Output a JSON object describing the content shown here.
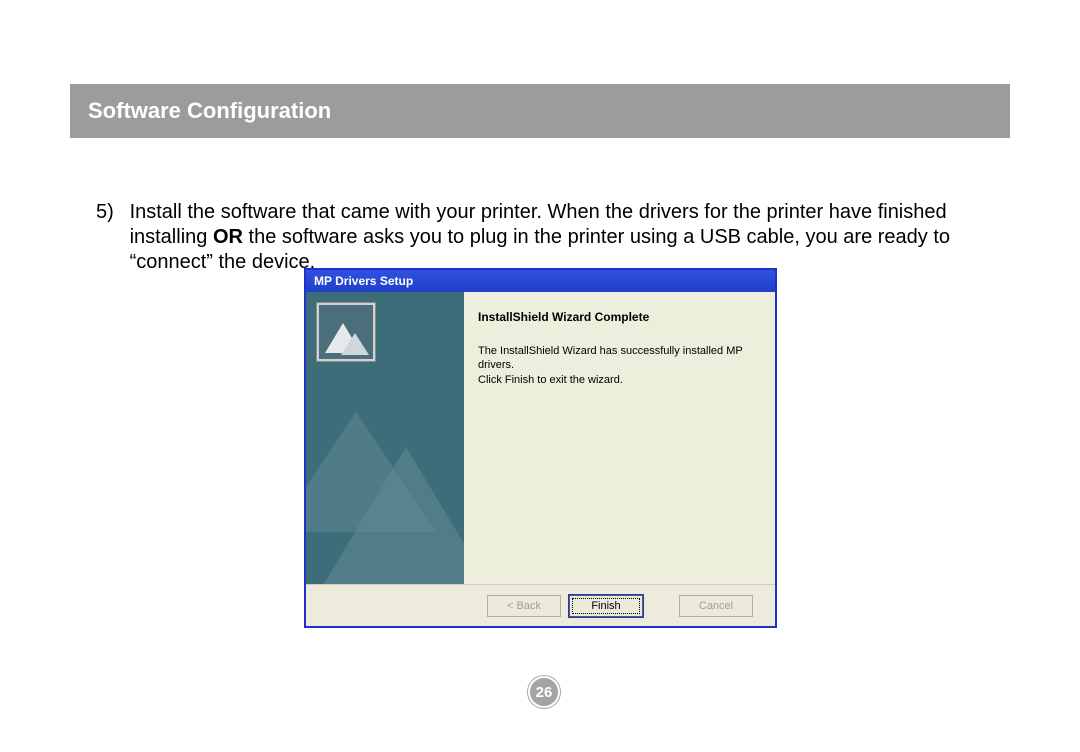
{
  "header": {
    "title": "Software Configuration"
  },
  "instruction": {
    "number": "5)",
    "text_before_bold": "Install the software that came with your printer.  When the drivers for the printer have finished installing ",
    "bold": "OR",
    "text_after_bold": " the software asks you to plug in the printer using a USB cable, you are ready to “connect” the device."
  },
  "dialog": {
    "title": "MP Drivers Setup",
    "wizard_title": "InstallShield Wizard Complete",
    "wizard_body_line1": "The InstallShield Wizard has successfully installed MP drivers.",
    "wizard_body_line2": "Click Finish to exit the wizard.",
    "buttons": {
      "back": "< Back",
      "finish": "Finish",
      "cancel": "Cancel"
    }
  },
  "page_number": "26"
}
